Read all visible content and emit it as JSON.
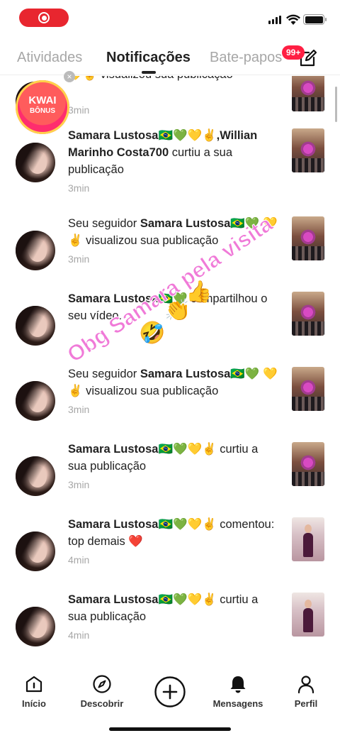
{
  "status_bar": {
    "battery_level": 1.0
  },
  "tabs": {
    "atividades": "Atividades",
    "notificacoes": "Notificações",
    "bate_papos": "Bate-papos",
    "badge": "99+"
  },
  "kwai_bonus": {
    "line1": "KWAI",
    "line2": "BÔNUS"
  },
  "overlay_text": "Obg Samara pela visita",
  "notifications": [
    {
      "prefix": "",
      "name": "",
      "rest": "💛✌️ visualizou sua publicação",
      "time": "3min",
      "thumb": "party"
    },
    {
      "prefix": "",
      "name": "Samara Lustosa🇧🇷💚💛✌️,Willian Marinho Costa700",
      "rest": " curtiu a sua publicação",
      "time": "3min",
      "thumb": "party"
    },
    {
      "prefix": "Seu seguidor ",
      "name": "Samara Lustosa🇧🇷💚",
      "rest": " 💛✌️ visualizou sua publicação",
      "time": "3min",
      "thumb": "party"
    },
    {
      "prefix": "",
      "name": "Samara Lustosa🇧🇷💚",
      "rest": " compartilhou o seu vídeo.",
      "time": "",
      "thumb": "party"
    },
    {
      "prefix": "Seu seguidor ",
      "name": "Samara Lustosa🇧🇷💚",
      "rest": " 💛✌️ visualizou sua publicação",
      "time": "3min",
      "thumb": "party"
    },
    {
      "prefix": "",
      "name": "Samara Lustosa🇧🇷💚💛✌️",
      "rest": " curtiu a sua publicação",
      "time": "3min",
      "thumb": "party"
    },
    {
      "prefix": "",
      "name": "Samara Lustosa🇧🇷💚💛✌️",
      "rest": " comentou: top demais ❤️",
      "time": "4min",
      "thumb": "dress"
    },
    {
      "prefix": "",
      "name": "Samara Lustosa🇧🇷💚💛✌️",
      "rest": " curtiu a sua publicação",
      "time": "4min",
      "thumb": "dress"
    }
  ],
  "bottom_nav": {
    "inicio": "Início",
    "descobrir": "Descobrir",
    "mensagens": "Mensagens",
    "perfil": "Perfil"
  },
  "colors": {
    "accent": "#ff1f43",
    "record": "#e8262f",
    "overlay": "#f07ad8"
  }
}
